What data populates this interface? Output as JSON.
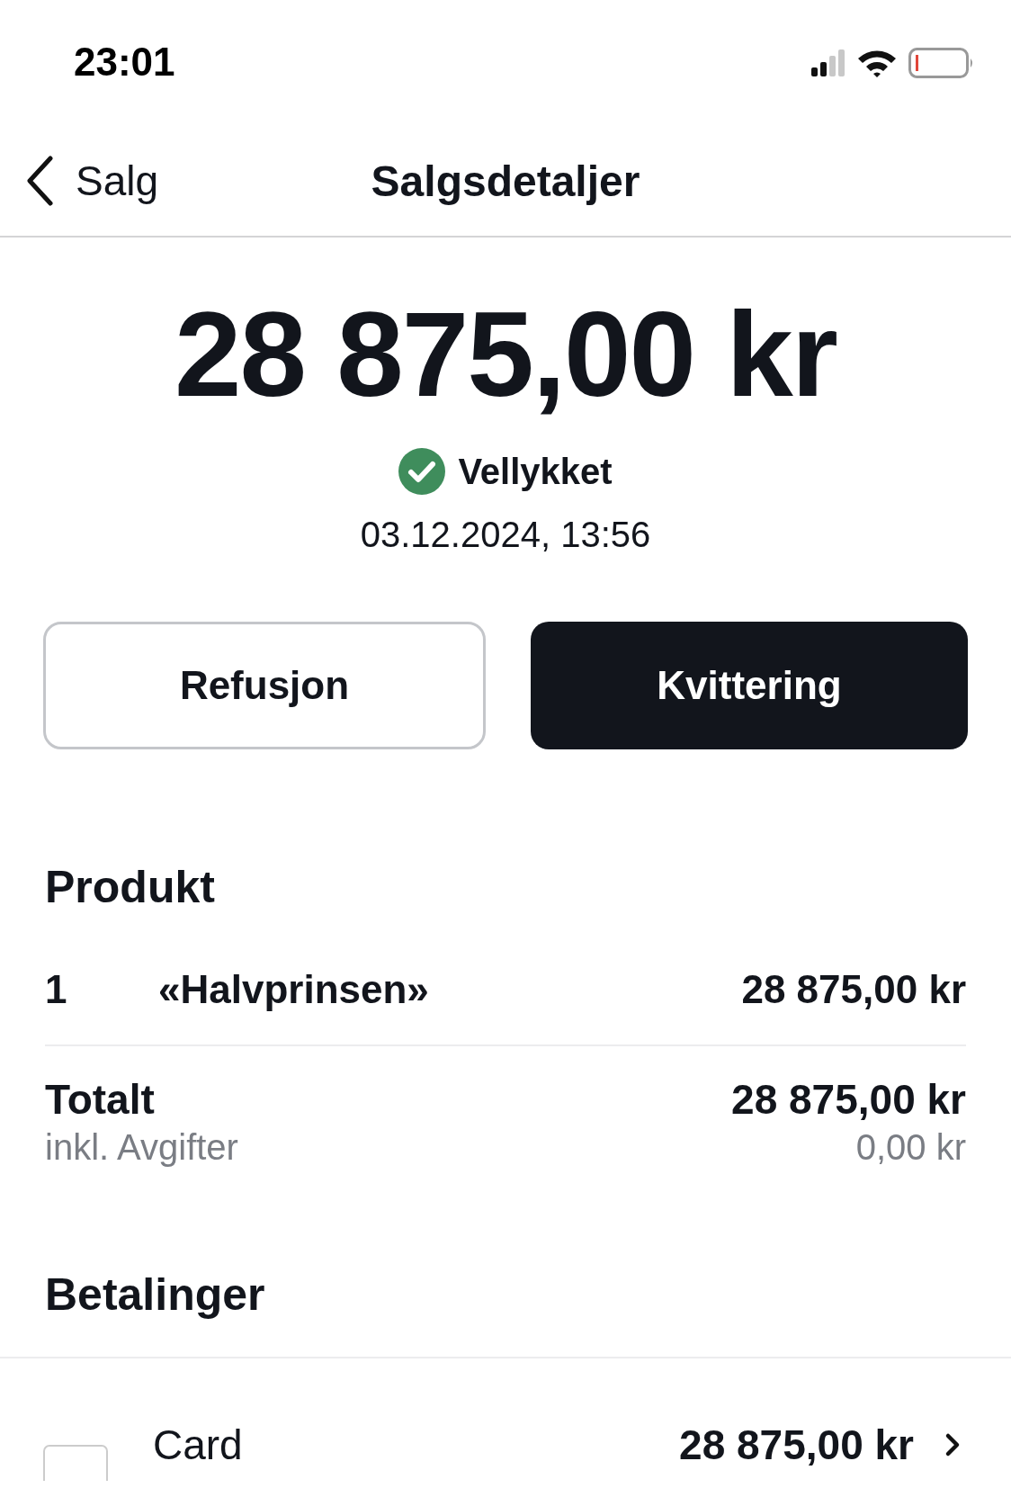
{
  "status_bar": {
    "time": "23:01"
  },
  "nav": {
    "back_label": "Salg",
    "title": "Salgsdetaljer"
  },
  "amount": "28 875,00 kr",
  "status": {
    "kind": "success",
    "label": "Vellykket"
  },
  "date": "03.12.2024, 13:56",
  "buttons": [
    {
      "label": "Refusjon",
      "kind": "secondary"
    },
    {
      "label": "Kvittering",
      "kind": "primary"
    }
  ],
  "products": {
    "title": "Produkt",
    "items": [
      {
        "qty": "1",
        "name": "«Halvprinsen»",
        "price": "28 875,00 kr"
      }
    ]
  },
  "total": {
    "label": "Totalt",
    "sub_label": "inkl. Avgifter",
    "value": "28 875,00 kr",
    "sub_value": "0,00 kr"
  },
  "payments": {
    "title": "Betalinger",
    "items": [
      {
        "method": "Card",
        "amount": "28 875,00 kr"
      }
    ]
  }
}
